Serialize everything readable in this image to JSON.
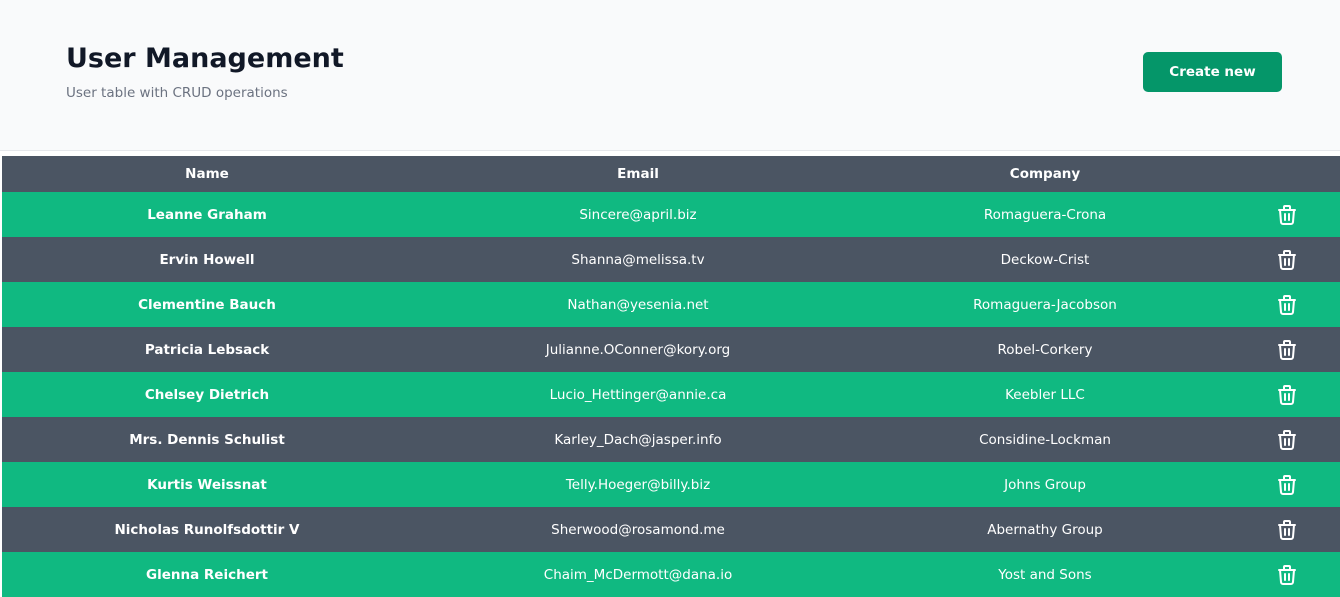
{
  "header": {
    "title": "User Management",
    "subtitle": "User table with CRUD operations",
    "create_label": "Create new"
  },
  "table": {
    "columns": [
      "Name",
      "Email",
      "Company",
      ""
    ],
    "rows": [
      {
        "name": "Leanne Graham",
        "email": "Sincere@april.biz",
        "company": "Romaguera-Crona"
      },
      {
        "name": "Ervin Howell",
        "email": "Shanna@melissa.tv",
        "company": "Deckow-Crist"
      },
      {
        "name": "Clementine Bauch",
        "email": "Nathan@yesenia.net",
        "company": "Romaguera-Jacobson"
      },
      {
        "name": "Patricia Lebsack",
        "email": "Julianne.OConner@kory.org",
        "company": "Robel-Corkery"
      },
      {
        "name": "Chelsey Dietrich",
        "email": "Lucio_Hettinger@annie.ca",
        "company": "Keebler LLC"
      },
      {
        "name": "Mrs. Dennis Schulist",
        "email": "Karley_Dach@jasper.info",
        "company": "Considine-Lockman"
      },
      {
        "name": "Kurtis Weissnat",
        "email": "Telly.Hoeger@billy.biz",
        "company": "Johns Group"
      },
      {
        "name": "Nicholas Runolfsdottir V",
        "email": "Sherwood@rosamond.me",
        "company": "Abernathy Group"
      },
      {
        "name": "Glenna Reichert",
        "email": "Chaim_McDermott@dana.io",
        "company": "Yost and Sons"
      }
    ],
    "row_action_icon": "trash-icon"
  },
  "colors": {
    "header_bg": "#f9fafb",
    "create_button": "#059669",
    "row_green": "#10b981",
    "row_gray": "#4b5563",
    "table_header": "#4b5563"
  }
}
